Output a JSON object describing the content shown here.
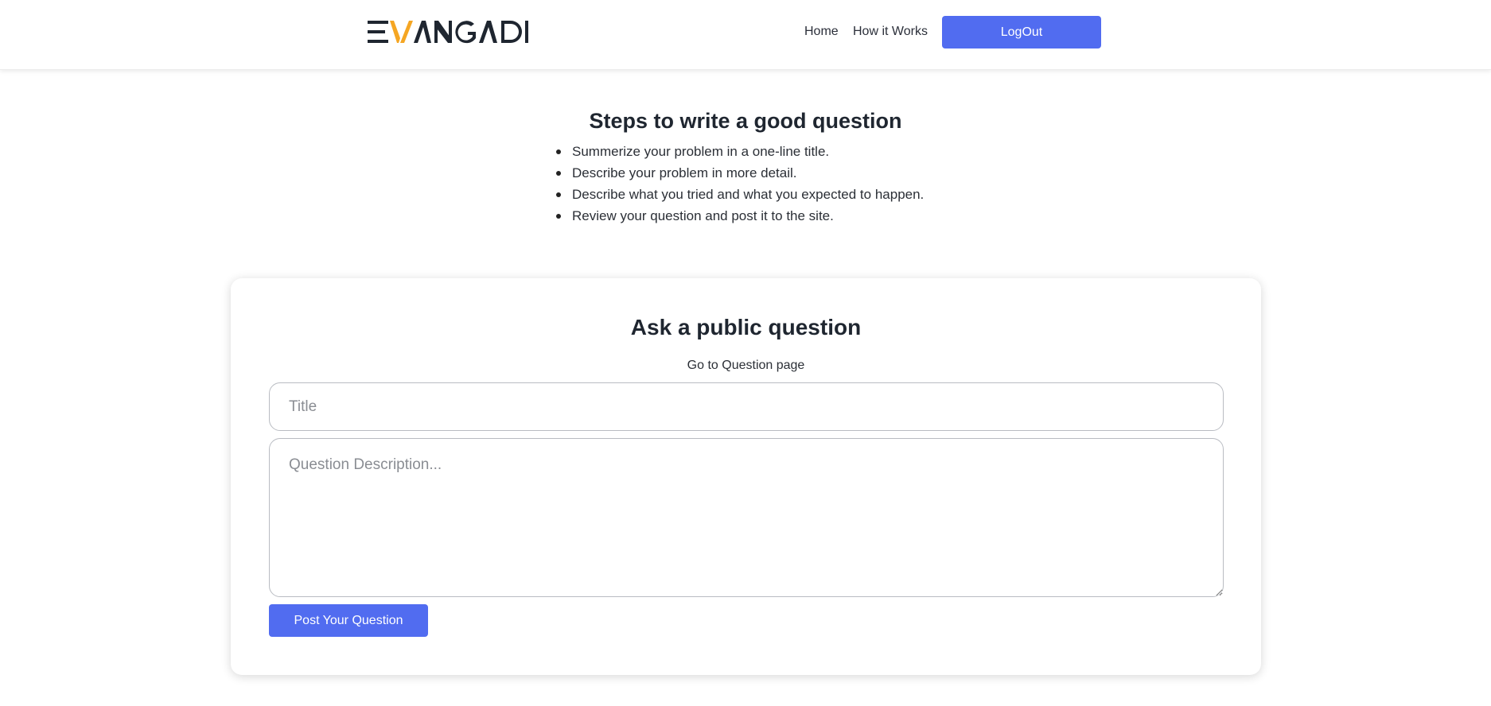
{
  "header": {
    "logo_text": "EVANGADI",
    "nav": {
      "home": "Home",
      "how_it_works": "How it Works"
    },
    "logout_label": "LogOut"
  },
  "steps": {
    "title": "Steps to write a good question",
    "items": [
      "Summerize your problem in a one-line title.",
      "Describe your problem in more detail.",
      "Describe what you tried and what you expected to happen.",
      "Review your question and post it to the site."
    ]
  },
  "ask_form": {
    "title": "Ask a public question",
    "link_text": "Go to Question page",
    "title_placeholder": "Title",
    "title_value": "",
    "description_placeholder": "Question Description...",
    "description_value": "",
    "submit_label": "Post Your Question"
  },
  "colors": {
    "accent": "#516cf0",
    "logo_orange": "#f5a623",
    "logo_dark": "#1f2630"
  }
}
